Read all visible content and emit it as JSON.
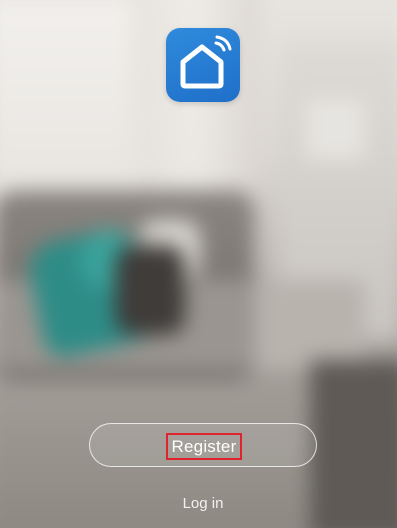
{
  "app": {
    "icon_name": "smart-home-wifi-icon",
    "icon_color": "#2b84d8"
  },
  "actions": {
    "register_label": "Register",
    "register_highlight_color": "#e0232d",
    "login_label": "Log in"
  }
}
